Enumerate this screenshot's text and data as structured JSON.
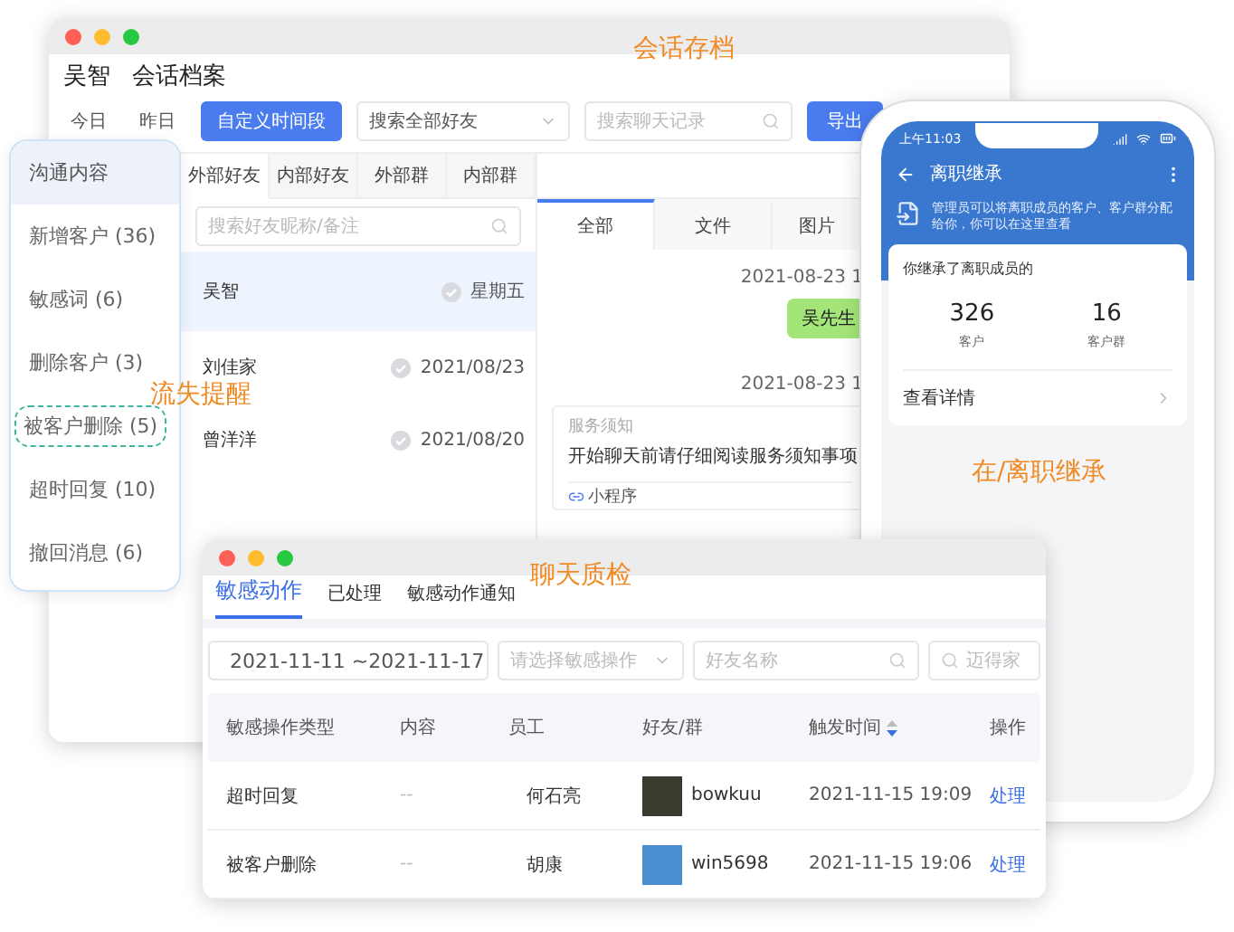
{
  "session_window": {
    "title": "会话存档",
    "user": "吴智",
    "heading": "会话档案",
    "date_filters": [
      {
        "label": "今日",
        "selected": false
      },
      {
        "label": "昨日",
        "selected": false
      },
      {
        "label": "自定义时间段",
        "selected": true
      }
    ],
    "friend_select": {
      "value": "搜索全部好友"
    },
    "chat_search": {
      "placeholder": "搜索聊天记录"
    },
    "export_button": "导出",
    "contact_tabs": [
      {
        "label": "外部好友",
        "selected": true
      },
      {
        "label": "内部好友",
        "selected": false
      },
      {
        "label": "外部群",
        "selected": false
      },
      {
        "label": "内部群",
        "selected": false
      }
    ],
    "contact_search": {
      "placeholder": "搜索好友昵称/备注"
    },
    "contacts": [
      {
        "name": "吴智",
        "time": "星期五",
        "selected": true
      },
      {
        "name": "刘佳家",
        "time": "2021/08/23",
        "selected": false
      },
      {
        "name": "曾洋洋",
        "time": "2021/08/20",
        "selected": false
      }
    ],
    "chat_tabs": [
      {
        "label": "全部",
        "selected": true
      },
      {
        "label": "文件",
        "selected": false
      },
      {
        "label": "图片",
        "selected": false
      }
    ],
    "messages": [
      {
        "kind": "time",
        "text": "2021-08-23 1"
      },
      {
        "kind": "bubble",
        "text": "吴先生"
      },
      {
        "kind": "time",
        "text": "2021-08-23 1"
      },
      {
        "kind": "card",
        "label": "服务须知",
        "text": "开始聊天前请仔细阅读服务须知事项",
        "footer": "小程序"
      }
    ]
  },
  "sidebar": {
    "items": [
      {
        "label": "沟通内容",
        "selected": true,
        "highlighted": false
      },
      {
        "label": "新增客户 (36)",
        "selected": false,
        "highlighted": false
      },
      {
        "label": "敏感词 (6)",
        "selected": false,
        "highlighted": false
      },
      {
        "label": "删除客户 (3)",
        "selected": false,
        "highlighted": false
      },
      {
        "label": "被客户删除 (5)",
        "selected": false,
        "highlighted": true
      },
      {
        "label": "超时回复 (10)",
        "selected": false,
        "highlighted": false
      },
      {
        "label": "撤回消息 (6)",
        "selected": false,
        "highlighted": false
      }
    ],
    "callout": "流失提醒"
  },
  "quality_window": {
    "title": "聊天质检",
    "tabs": [
      {
        "label": "敏感动作",
        "selected": true
      },
      {
        "label": "已处理",
        "selected": false
      },
      {
        "label": "敏感动作通知",
        "selected": false
      }
    ],
    "date_range": "2021-11-11 ~2021-11-17",
    "action_select": {
      "placeholder": "请选择敏感操作"
    },
    "friend_search": {
      "placeholder": "好友名称"
    },
    "staff_search": {
      "placeholder": "迈得家"
    },
    "columns": [
      {
        "label": "敏感操作类型",
        "sorted": false
      },
      {
        "label": "内容",
        "sorted": false
      },
      {
        "label": "员工",
        "sorted": false
      },
      {
        "label": "好友/群",
        "sorted": false
      },
      {
        "label": "触发时间",
        "sorted": true
      },
      {
        "label": "操作",
        "sorted": false
      }
    ],
    "rows": [
      {
        "type": "超时回复",
        "content": "--",
        "staff": "何石亮",
        "friend": "bowkuu",
        "time": "2021-11-15 19:09",
        "action": "处理"
      },
      {
        "type": "被客户删除",
        "content": "--",
        "staff": "胡康",
        "friend": "win5698",
        "time": "2021-11-15 19:06",
        "action": "处理"
      }
    ]
  },
  "phone": {
    "status_time": "上午11:03",
    "title": "离职继承",
    "notice": "管理员可以将离职成员的客户、客户群分配给你，你可以在这里查看",
    "card_title": "你继承了离职成员的",
    "stats": [
      {
        "value": "326",
        "label": "客户"
      },
      {
        "value": "16",
        "label": "客户群"
      }
    ],
    "details_link": "查看详情",
    "caption": "在/离职继承"
  }
}
